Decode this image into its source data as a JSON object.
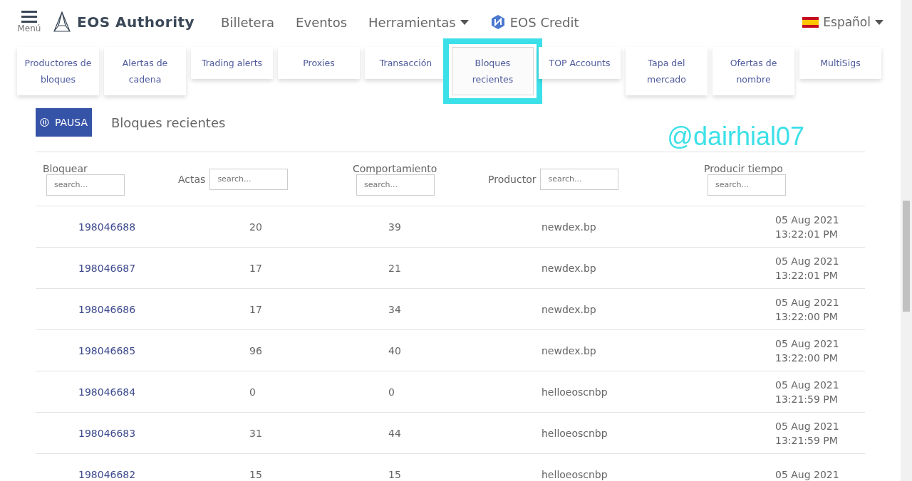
{
  "header": {
    "menu_label": "Menú",
    "brand": "EOS Authority",
    "nav": [
      {
        "label": "Billetera",
        "dropdown": false
      },
      {
        "label": "Eventos",
        "dropdown": false
      },
      {
        "label": "Herramientas",
        "dropdown": true
      },
      {
        "label": "EOS Credit",
        "dropdown": false,
        "icon": true
      }
    ],
    "language": "Español"
  },
  "tools": [
    {
      "label": "Productores de bloques",
      "selected": false
    },
    {
      "label": "Alertas de cadena",
      "selected": false
    },
    {
      "label": "Trading alerts",
      "selected": false
    },
    {
      "label": "Proxies",
      "selected": false
    },
    {
      "label": "Transacción",
      "selected": false
    },
    {
      "label": "Bloques recientes",
      "selected": true
    },
    {
      "label": "TOP Accounts",
      "selected": false
    },
    {
      "label": "Tapa del mercado",
      "selected": false
    },
    {
      "label": "Ofertas de nombre",
      "selected": false
    },
    {
      "label": "MultiSigs",
      "selected": false
    }
  ],
  "pause_button": "PAUSA",
  "section_title": "Bloques recientes",
  "annotation": "@dairhial07",
  "table": {
    "columns": [
      {
        "label": "Bloquear",
        "placeholder": "search...",
        "kind": "stacked"
      },
      {
        "label": "Actas",
        "placeholder": "search...",
        "kind": "inline"
      },
      {
        "label": "Comportamiento",
        "placeholder": "search...",
        "kind": "stacked"
      },
      {
        "label": "Productor",
        "placeholder": "search...",
        "kind": "inline"
      },
      {
        "label": "Producir tiempo",
        "placeholder": "search...",
        "kind": "stacked"
      }
    ],
    "rows": [
      {
        "block": "198046688",
        "actions": "20",
        "behavior": "39",
        "producer": "newdex.bp",
        "date": "05 Aug 2021",
        "time": "13:22:01 PM"
      },
      {
        "block": "198046687",
        "actions": "17",
        "behavior": "21",
        "producer": "newdex.bp",
        "date": "05 Aug 2021",
        "time": "13:22:01 PM"
      },
      {
        "block": "198046686",
        "actions": "17",
        "behavior": "34",
        "producer": "newdex.bp",
        "date": "05 Aug 2021",
        "time": "13:22:00 PM"
      },
      {
        "block": "198046685",
        "actions": "96",
        "behavior": "40",
        "producer": "newdex.bp",
        "date": "05 Aug 2021",
        "time": "13:22:00 PM"
      },
      {
        "block": "198046684",
        "actions": "0",
        "behavior": "0",
        "producer": "helloeoscnbp",
        "date": "05 Aug 2021",
        "time": "13:21:59 PM"
      },
      {
        "block": "198046683",
        "actions": "31",
        "behavior": "44",
        "producer": "helloeoscnbp",
        "date": "05 Aug 2021",
        "time": "13:21:59 PM"
      },
      {
        "block": "198046682",
        "actions": "15",
        "behavior": "15",
        "producer": "helloeoscnbp",
        "date": "05 Aug 2021"
      }
    ]
  }
}
